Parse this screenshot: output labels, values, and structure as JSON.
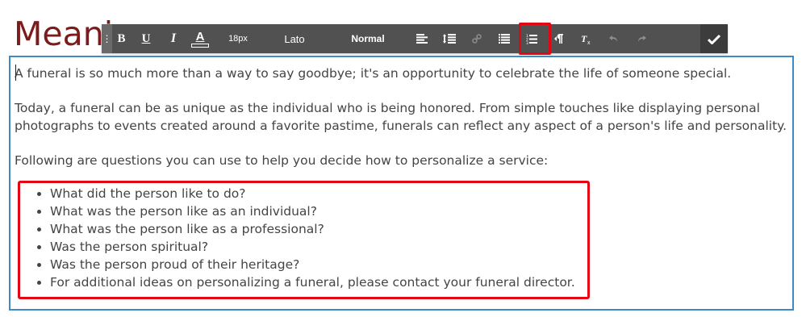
{
  "page": {
    "title": "Meaningful Service"
  },
  "toolbar": {
    "grip": "⋮",
    "bold": "B",
    "underline": "U",
    "italic": "I",
    "font_color": "A",
    "font_size": "18px",
    "font_family": "Lato",
    "paragraph_format": "Normal",
    "confirm_icon": "check-icon",
    "icons": [
      "align-left-icon",
      "line-height-icon",
      "link-icon",
      "bulleted-list-icon",
      "numbered-list-icon",
      "paragraph-icon",
      "clear-formatting-icon",
      "undo-icon",
      "redo-icon"
    ],
    "highlight_color": "#e30613",
    "background": "#515151"
  },
  "editor": {
    "border_color": "#3d8ac8",
    "paragraphs": [
      "A funeral is so much more than a way to say goodbye; it's an opportunity to celebrate the life of someone special.",
      "Today, a funeral can be as unique as the individual who is being honored. From simple touches like displaying personal photographs to events created around a favorite pastime, funerals can reflect any aspect of a person's life and personality.",
      "Following are questions you can use to help you decide how to personalize a service:"
    ],
    "bullets": [
      "What did the person like to do?",
      "What was the person like as an individual?",
      "What was the person like as a professional?",
      "Was the person spiritual?",
      "Was the person proud of their heritage?",
      "For additional ideas on personalizing a funeral, please contact your funeral director."
    ]
  }
}
